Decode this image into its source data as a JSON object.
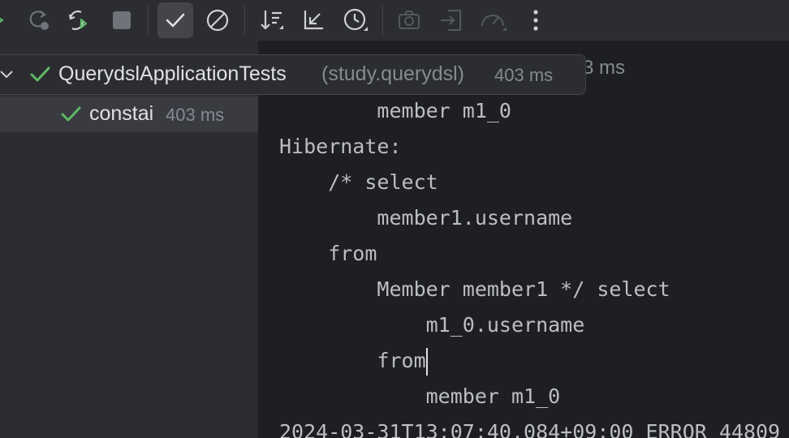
{
  "toolbar": {
    "icons": [
      {
        "name": "rerun-icon"
      },
      {
        "name": "rerun-failed-icon"
      },
      {
        "name": "toggle-auto-test-icon"
      },
      {
        "name": "stop-icon"
      },
      {
        "name": "show-passed-icon",
        "active": true
      },
      {
        "name": "show-ignored-icon"
      },
      {
        "name": "sort-icon"
      },
      {
        "name": "collapse-icon"
      },
      {
        "name": "history-icon"
      },
      {
        "name": "screenshot-icon"
      },
      {
        "name": "import-tests-icon"
      },
      {
        "name": "profiler-icon"
      },
      {
        "name": "more-options-icon"
      }
    ]
  },
  "tree": {
    "root": {
      "name": "QuerydslApplicationTests",
      "package": "(study.querydsl)",
      "time": "403 ms",
      "status": "passed"
    },
    "child": {
      "name": "constai",
      "time": "403 ms",
      "status": "passed"
    }
  },
  "console": {
    "header_time": "3 ms",
    "lines": [
      "        member m1_0",
      "Hibernate:",
      "    /* select",
      "        member1.username",
      "    from",
      "        Member member1 */ select",
      "            m1_0.username",
      "        from",
      "            member m1_0",
      "2024-03-31T13:07:40.084+09:00 ERROR 44809"
    ]
  },
  "colors": {
    "pass_green": "#5fb865",
    "toolbar_bg": "#2b2d30",
    "console_bg": "#1e1f22",
    "text": "#bcbec4"
  }
}
